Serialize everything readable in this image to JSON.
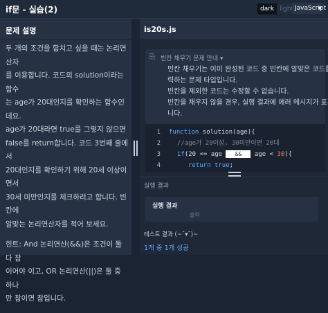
{
  "header": {
    "title": "if문 - 실습(2)",
    "theme_dark": "dark",
    "theme_light": "light",
    "language": "JavaScript",
    "language_icon": "chevron-down-icon"
  },
  "problem": {
    "heading": "문제 설명",
    "lines": [
      "두 개의 조건을 합치고 싶을 때는 논리연산자",
      "를 이용합니다. 코드의 solution이라는 함수",
      "는 age가 20대인지를 확인하는 함수인데요.",
      "age가 20대라면 true를 그렇지 않으면",
      "false를 return합니다. 코드 3번째 줄에서",
      "20대인지를 확인하기 위해 20세 이상이면서",
      "30세 미만인지를 체크하려고 합니다. 빈칸에",
      "알맞는 논리연산자를 적어 보세요."
    ],
    "hint_lines": [
      "힌트: And 논리연산(&&)은 조건이 둘 다 참",
      "이어야 이고, OR 논리연산(||)은 둘 중 하나",
      "만 참이면 참입니다."
    ]
  },
  "editor": {
    "file_name": "is20s.js",
    "notice_title": "빈칸 채우기 문제 안내 ▾",
    "notice_lines": [
      "빈칸 채우기는 이미 완성된 코드 중 빈칸에 알맞은 코드를 입",
      "력하는 문제 타입입니다.",
      "빈칸을 제외한 코드는 수정할 수 없습니다.",
      "빈칸을 채우지 않을 경우, 실행 결과에 에러 메시지가 표시됩",
      "니다."
    ],
    "code": {
      "l1": {
        "num": "1",
        "kw": "function",
        "rest": " solution(age){"
      },
      "l2": {
        "num": "2",
        "comment": "//age가 20이상, 30미만이면 20대"
      },
      "l3": {
        "num": "3",
        "kw": "if",
        "a": "(20",
        "b": " <= age ",
        "blank": "&&",
        "c": " age < ",
        "d": "30",
        "e": "){"
      },
      "l4": {
        "num": "4",
        "kw": "return",
        "v": " true",
        "e": ";"
      }
    }
  },
  "results": {
    "heading": "실행 결과",
    "run_title": "실행 결과",
    "output_placeholder": "출력",
    "test_label": "테스트 결과 (~˘▾˘)~",
    "test_summary": "1개 중 1개 성공"
  }
}
